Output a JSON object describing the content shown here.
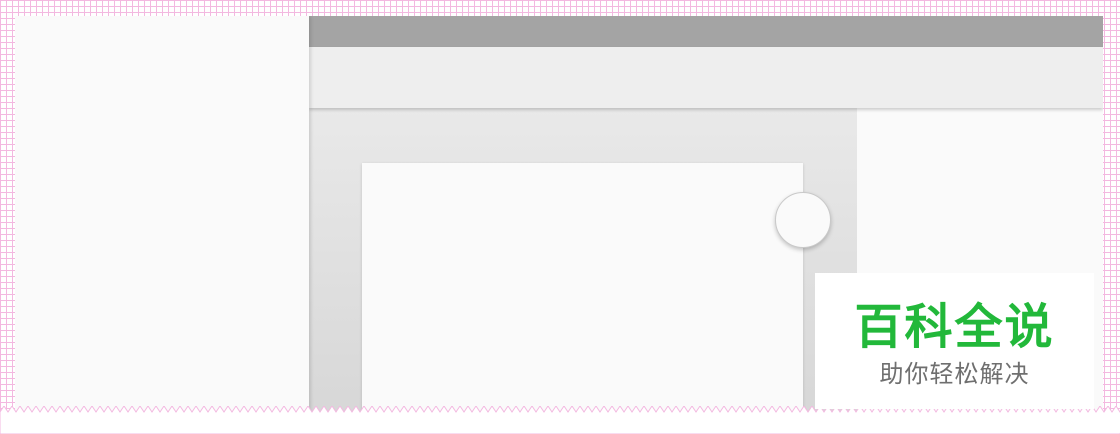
{
  "watermark": {
    "title": "百科全说",
    "subtitle": "助你轻松解决",
    "title_color": "#22b83a",
    "subtitle_color": "#6f6f6f"
  },
  "colors": {
    "status_bar": "#a4a4a4",
    "app_bar": "#eeeeee",
    "surface": "#fafafa",
    "background_grid": "#f3b8e0"
  }
}
